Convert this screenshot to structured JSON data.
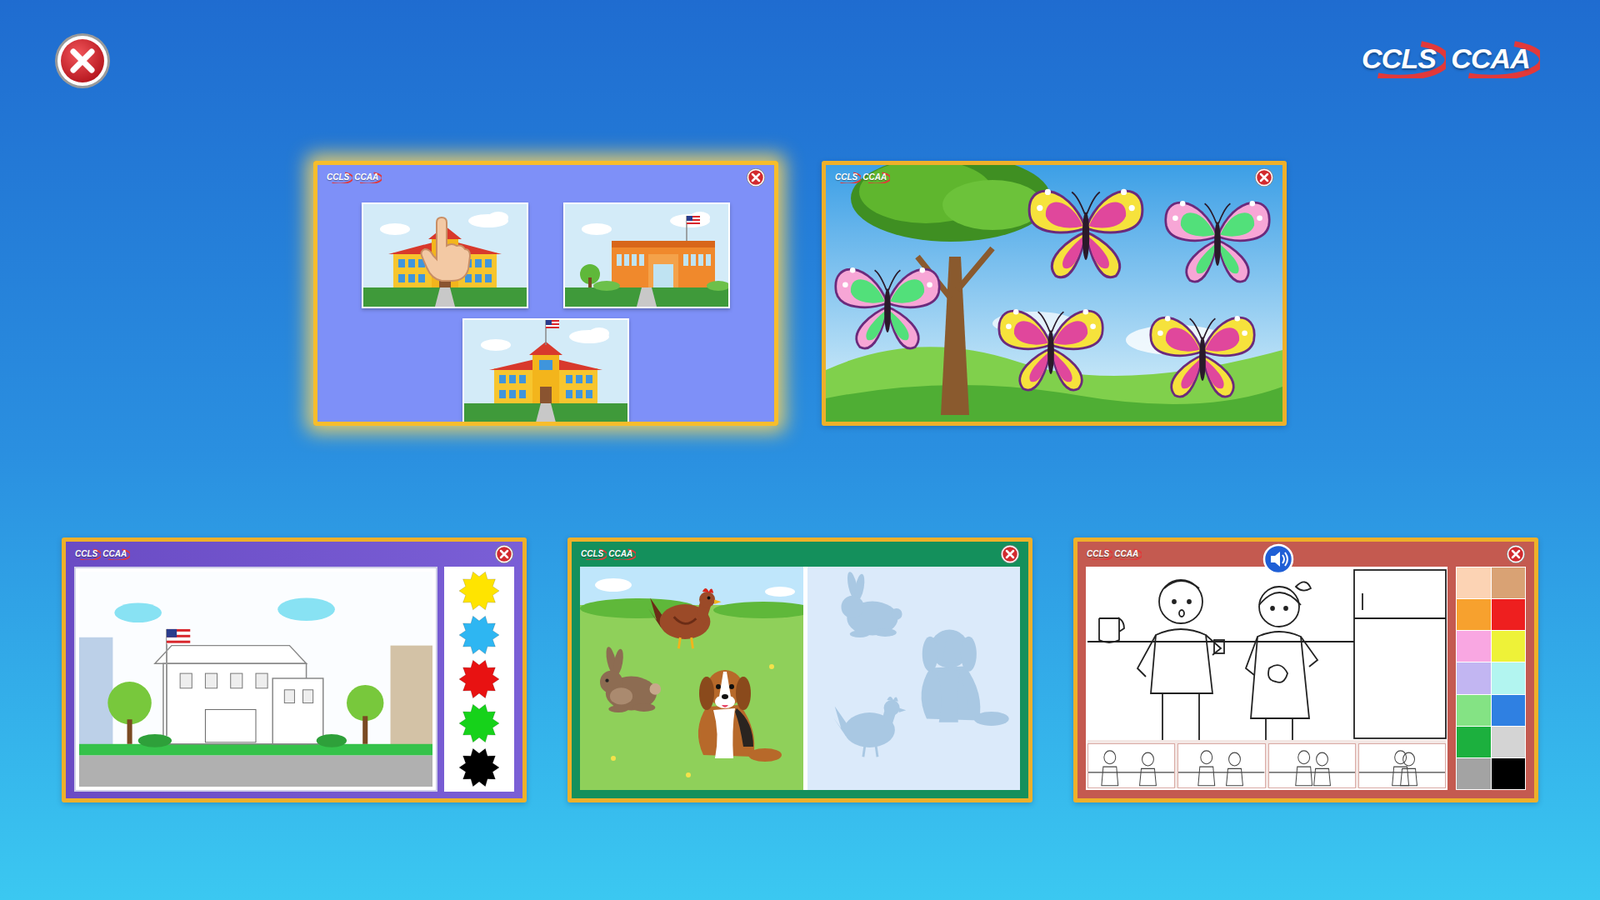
{
  "logo": [
    "CCLS",
    "CCAA"
  ],
  "cards": [
    {
      "kind": "pick-school",
      "selected": true,
      "logo": [
        "CCLS",
        "CCAA"
      ]
    },
    {
      "kind": "butterflies",
      "selected": false,
      "logo": [
        "CCLS",
        "CCAA"
      ],
      "butterflies": [
        {
          "color": "#f7a6d6",
          "inner_color": "#52e07a"
        },
        {
          "color": "#f6e23c",
          "inner_color": "#e0479c"
        },
        {
          "color": "#f7a6d6",
          "inner_color": "#52e07a"
        },
        {
          "color": "#f6e23c",
          "inner_color": "#e0479c"
        },
        {
          "color": "#f6e23c",
          "inner_color": "#e0479c"
        }
      ]
    },
    {
      "kind": "paint",
      "selected": false,
      "logo": [
        "CCLS",
        "CCAA"
      ],
      "paints": [
        {
          "color": "#ffe400"
        },
        {
          "color": "#2eb6f2"
        },
        {
          "color": "#e81212"
        },
        {
          "color": "#16d21a"
        },
        {
          "color": "#000000"
        }
      ]
    },
    {
      "kind": "shadow-match",
      "selected": false,
      "logo": [
        "CCLS",
        "CCAA"
      ]
    },
    {
      "kind": "coloring",
      "selected": false,
      "logo": [
        "CCLS",
        "CCAA"
      ],
      "palette": [
        {
          "color": "#fcd3b4"
        },
        {
          "color": "#d9a274"
        },
        {
          "color": "#f7a12e"
        },
        {
          "color": "#ee1f1f"
        },
        {
          "color": "#f9a7e2"
        },
        {
          "color": "#eef238"
        },
        {
          "color": "#c2b6f2"
        },
        {
          "color": "#b2f5f0"
        },
        {
          "color": "#84e384"
        },
        {
          "color": "#2f80e2"
        },
        {
          "color": "#1cb03e"
        },
        {
          "color": "#d4d4d4"
        },
        {
          "color": "#a3a3a3"
        },
        {
          "color": "#000000"
        }
      ]
    }
  ]
}
